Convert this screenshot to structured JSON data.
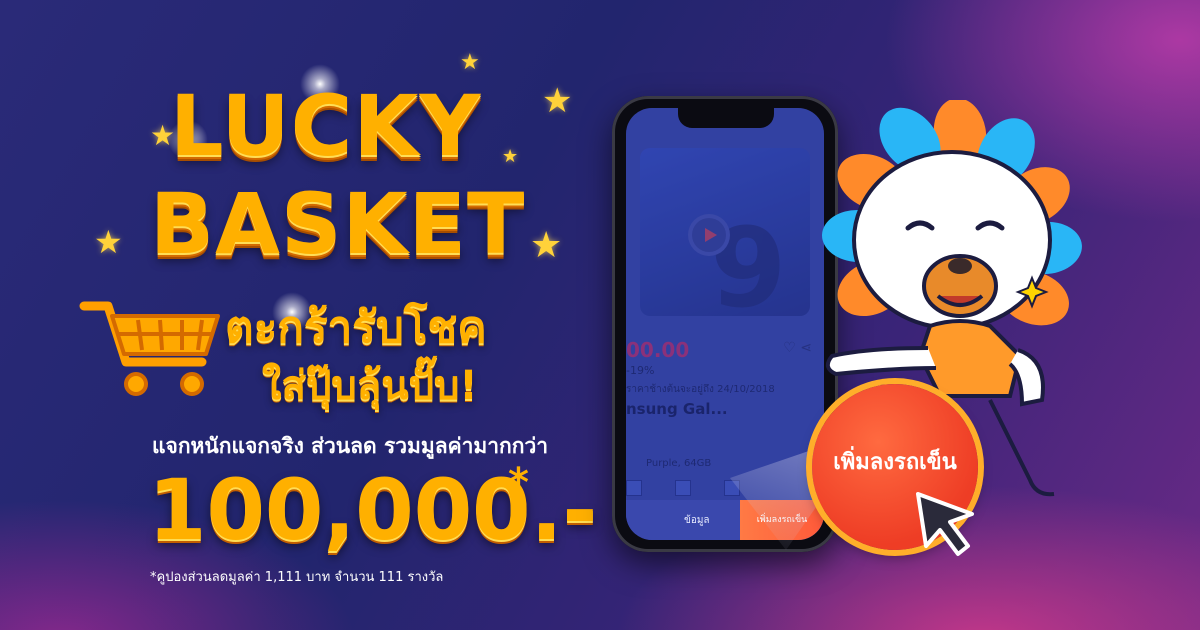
{
  "headline": {
    "line1": "LUCKY",
    "line2": "BASKET",
    "thai_line1": "ตะกร้ารับโชค",
    "thai_line2": "ใส่ปุ๊บลุ้นปั๊บ!"
  },
  "offer": {
    "subline": "แจกหนักแจกจริง ส่วนลด รวมมูลค่ามากกว่า",
    "amount": "100,000.-",
    "asterisk": "*",
    "footnote": "*คูปองส่วนลดมูลค่า 1,111 บาท จำนวน 111 รางวัล"
  },
  "phone": {
    "price": "00.00",
    "discount": "-19%",
    "deal_text": "ราคาช้างต้นจะอยู่ถึง 24/10/2018",
    "product_name": "nsung Gal...",
    "variant": "Purple, 64GB",
    "tab_detail": "ข้อมูล",
    "tab_add": "เพิ่มลงรถเข็น"
  },
  "cta": {
    "label": "เพิ่มลงรถเข็น"
  },
  "colors": {
    "accent": "#ffb000",
    "cta": "#ee3d25",
    "background": "#22256e"
  },
  "icons": [
    "cart-icon",
    "star-icon",
    "cursor-icon",
    "heart-icon",
    "share-icon",
    "play-icon",
    "mascot-illustration"
  ]
}
